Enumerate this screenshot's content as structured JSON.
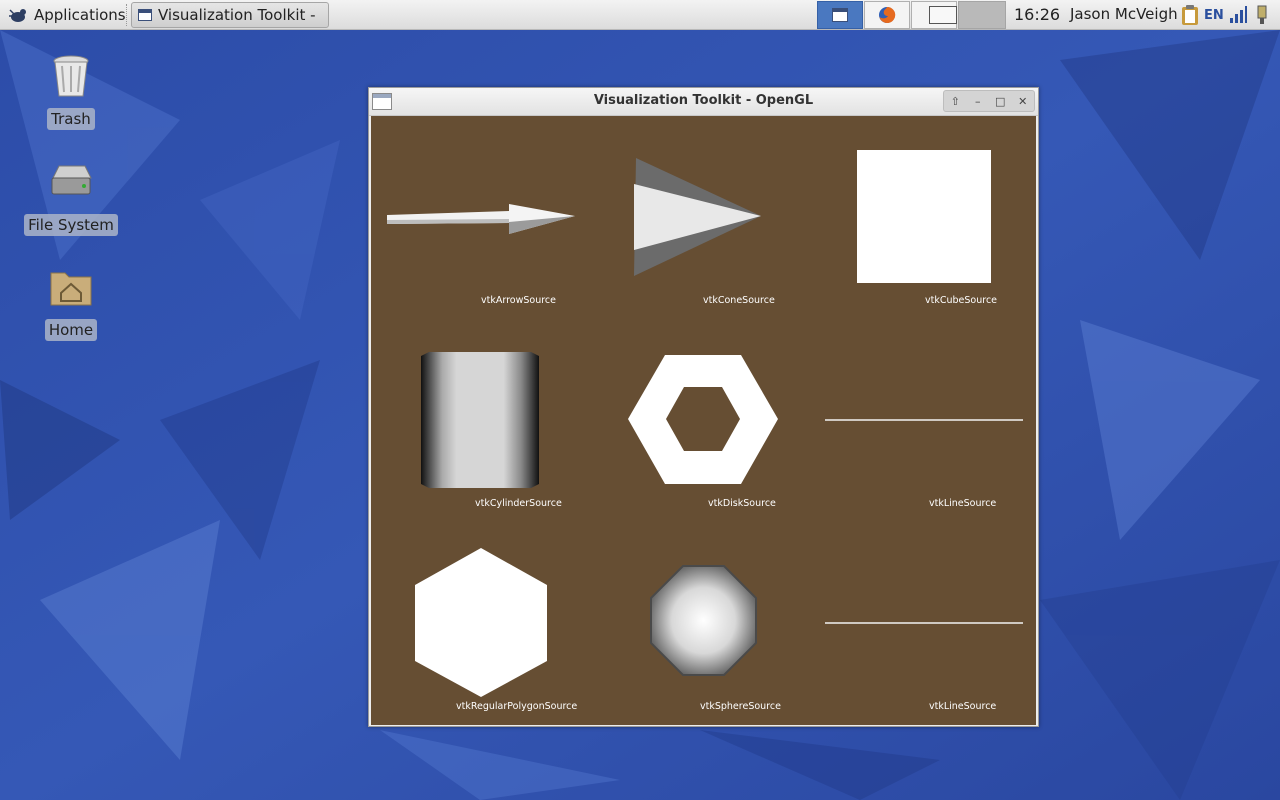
{
  "top_panel": {
    "applications_label": "Applications",
    "task_label": "Visualization Toolkit - …",
    "clock": "16:26",
    "user": "Jason McVeigh",
    "language": "EN"
  },
  "desktop_icons": [
    {
      "label": "Trash",
      "icon": "trash-icon"
    },
    {
      "label": "File System",
      "icon": "drive-icon"
    },
    {
      "label": "Home",
      "icon": "home-folder-icon"
    }
  ],
  "window": {
    "title": "Visualization Toolkit - OpenGL",
    "buttons": {
      "shade": "⇧",
      "minimize": "–",
      "maximize": "□",
      "close": "✕"
    }
  },
  "vtk_labels": [
    "vtkArrowSource",
    "vtkConeSource",
    "vtkCubeSource",
    "vtkCylinderSource",
    "vtkDiskSource",
    "vtkLineSource",
    "vtkRegularPolygonSource",
    "vtkSphereSource",
    "vtkLineSource"
  ],
  "colors": {
    "viewport_bg": "#664e33",
    "panel_accent": "#4a78c0"
  }
}
